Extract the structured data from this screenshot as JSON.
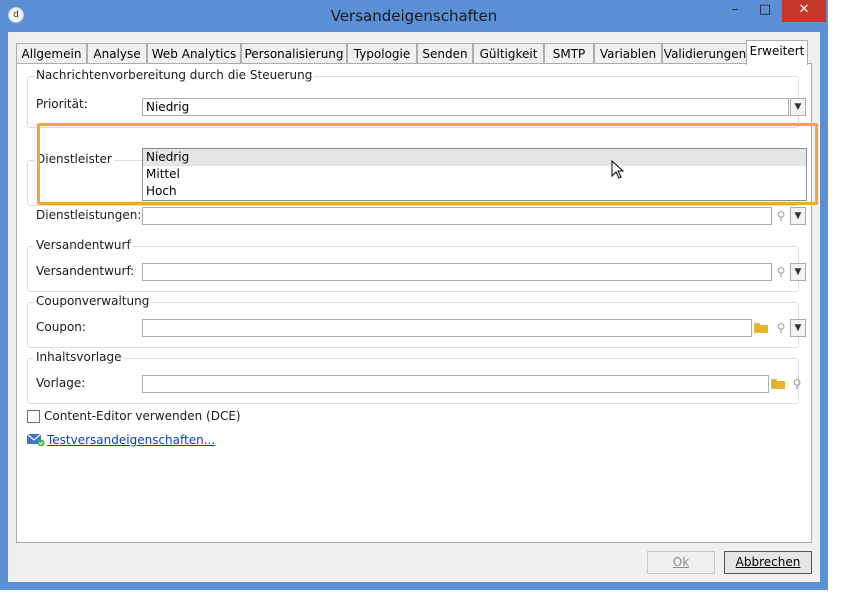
{
  "window": {
    "title": "Versandeigenschaften",
    "app_icon_glyph": "d",
    "minimize": "–",
    "maximize": "□",
    "close": "✕"
  },
  "tabs": [
    {
      "label": "Allgemein"
    },
    {
      "label": "Analyse"
    },
    {
      "label": "Web Analytics"
    },
    {
      "label": "Personalisierung"
    },
    {
      "label": "Typologie"
    },
    {
      "label": "Senden"
    },
    {
      "label": "Gültigkeit"
    },
    {
      "label": "SMTP"
    },
    {
      "label": "Variablen"
    },
    {
      "label": "Validierungen"
    },
    {
      "label": "Erweitert",
      "active": true
    }
  ],
  "nachricht": {
    "group_title": "Nachrichtenvorbereitung durch die Steuerung",
    "priority_label": "Priorität:",
    "priority_value": "Niedrig",
    "options": [
      "Niedrig",
      "Mittel",
      "Hoch"
    ]
  },
  "dienst": {
    "group_title": "Dienstleister",
    "label": "Dienstleistungen:",
    "value": ""
  },
  "versandentwurf": {
    "group_title": "Versandentwurf",
    "label": "Versandentwurf:",
    "value": ""
  },
  "coupon": {
    "group_title": "Couponverwaltung",
    "label": "Coupon:",
    "value": ""
  },
  "vorlage": {
    "group_title": "Inhaltsvorlage",
    "label": "Vorlage:",
    "value": ""
  },
  "dce": {
    "label": "Content-Editor verwenden (DCE)",
    "checked": false
  },
  "test_link": {
    "label": "Testversandeigenschaften..."
  },
  "buttons": {
    "ok": "Ok",
    "cancel": "Abbrechen"
  },
  "icons": {
    "search": "search-icon",
    "folder": "folder-icon",
    "chevron": "chevron-down-icon"
  },
  "colors": {
    "titlebar": "#5b8fd6",
    "close": "#c7382a",
    "highlight": "#f0a63a",
    "link": "#0645ad"
  }
}
